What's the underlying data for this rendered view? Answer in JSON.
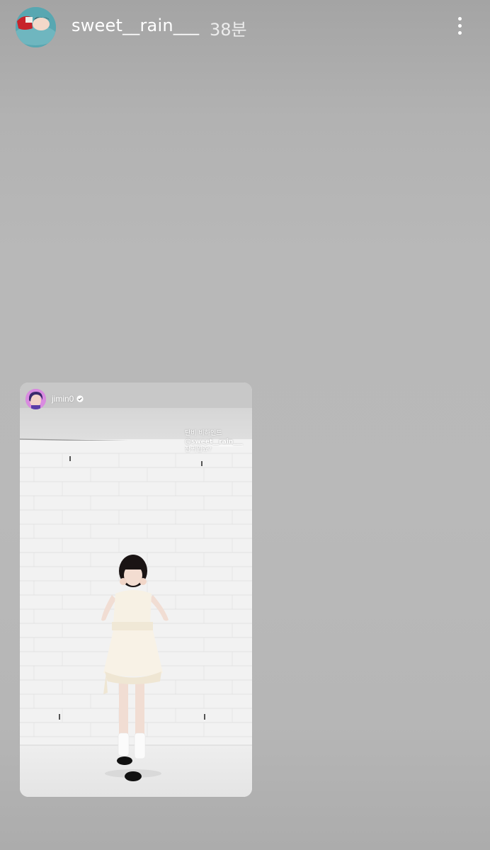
{
  "story": {
    "username": "sweet__rain___",
    "timestamp": "38분",
    "more_icon": "more-vertical-icon"
  },
  "shared_story": {
    "username": "jimin0",
    "verified_icon": "verified-badge-icon",
    "caption": {
      "line1": "단비 비하인드",
      "mention": "@sweet__rain___",
      "line3": "참귀엽죠?"
    }
  },
  "colors": {
    "background": "#b8b8b8",
    "header_text": "#ffffff",
    "wall": "#f1f1f1"
  }
}
